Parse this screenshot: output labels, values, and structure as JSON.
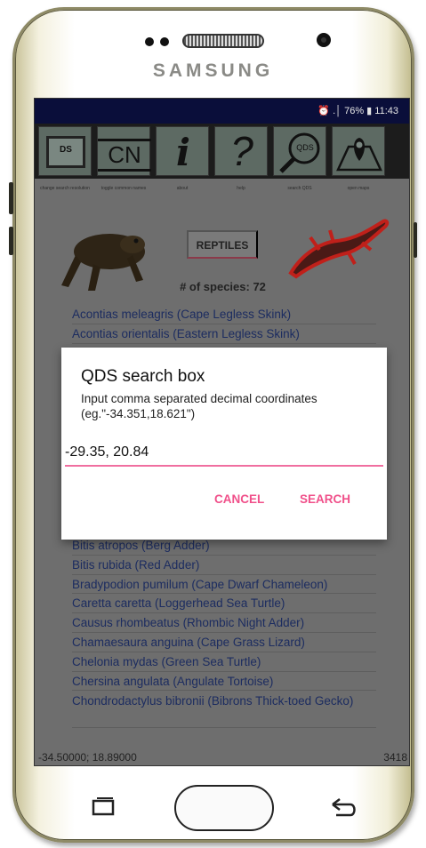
{
  "device": {
    "brand": "SAMSUNG"
  },
  "status_bar": {
    "text": "⏰ .│ 76% ▮ 11:43"
  },
  "toolbar": {
    "buttons": [
      {
        "glyph": "DS",
        "label": "change search resolution"
      },
      {
        "glyph": "CN",
        "label": "toggle common names"
      },
      {
        "glyph": "i",
        "label": "about"
      },
      {
        "glyph": "?",
        "label": "help"
      },
      {
        "glyph": "QDS",
        "label": "search QDS"
      },
      {
        "glyph": "map-pin",
        "label": "open maps"
      }
    ]
  },
  "header": {
    "category_button": "REPTILES",
    "species_count": "# of species: 72"
  },
  "species_list_top": [
    "Acontias meleagris (Cape Legless Skink)",
    "Acontias orientalis (Eastern Legless Skink)"
  ],
  "species_list_bottom": [
    "Bitis atropos (Berg Adder)",
    "Bitis rubida (Red Adder)",
    "Bradypodion pumilum (Cape Dwarf Chameleon)",
    "Caretta caretta (Loggerhead Sea Turtle)",
    "Causus rhombeatus (Rhombic Night Adder)",
    "Chamaesaura anguina (Cape Grass Lizard)",
    "Chelonia mydas (Green Sea Turtle)",
    "Chersina angulata (Angulate Tortoise)",
    "Chondrodactylus bibronii (Bibrons Thick-toed Gecko)"
  ],
  "footer": {
    "coords": "-34.50000; 18.89000",
    "number": "3418"
  },
  "dialog": {
    "title": "QDS search box",
    "message": "Input comma separated decimal coordinates (eg.\"-34.351,18.621\")",
    "input_value": "-29.35, 20.84",
    "cancel_label": "CANCEL",
    "search_label": "SEARCH"
  },
  "colors": {
    "accent": "#f0508a",
    "status_bar": "#0a0e3a",
    "list_text": "#1c2c60"
  }
}
